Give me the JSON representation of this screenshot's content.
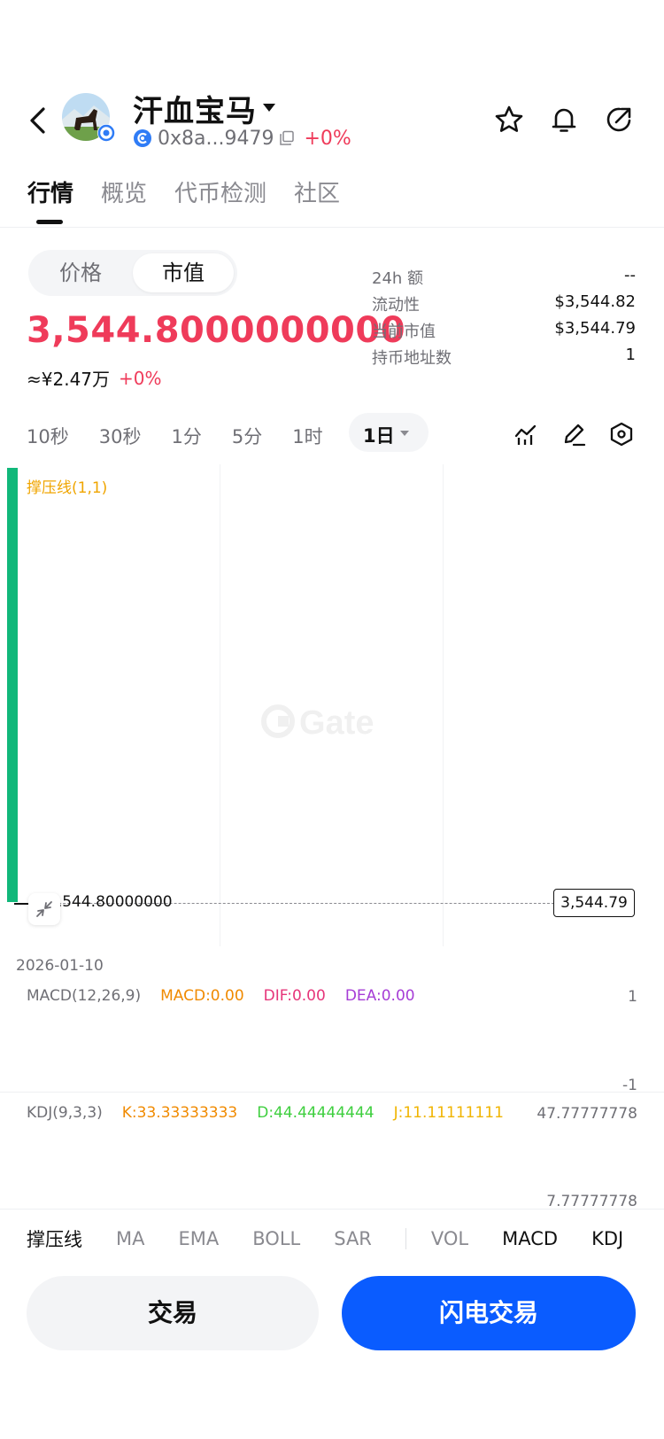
{
  "header": {
    "token_name": "汗血宝马",
    "address": "0x8a...9479",
    "change": "+0%"
  },
  "tabs": [
    {
      "label": "行情",
      "active": true
    },
    {
      "label": "概览",
      "active": false
    },
    {
      "label": "代币检测",
      "active": false
    },
    {
      "label": "社区",
      "active": false
    }
  ],
  "toggle": {
    "price": "价格",
    "market_cap": "市值",
    "selected": "市值"
  },
  "summary": {
    "value": "3,544.8000000000",
    "cny": "≈¥2.47万",
    "change": "+0%"
  },
  "stats": [
    {
      "label": "24h  额",
      "value": "--"
    },
    {
      "label": "流动性",
      "value": "$3,544.82"
    },
    {
      "label": "当前市值",
      "value": "$3,544.79"
    },
    {
      "label": "持币地址数",
      "value": "1"
    }
  ],
  "intervals": [
    "10秒",
    "30秒",
    "1分",
    "5分",
    "1时"
  ],
  "selected_interval": "1日",
  "chart": {
    "sr_label": "撑压线(1,1)",
    "line_price": "3,544.80000000",
    "last_price": "3,544.79",
    "date": "2026-01-10",
    "watermark": "Gate"
  },
  "macd": {
    "name": "MACD(12,26,9)",
    "macd": "MACD:0.00",
    "dif": "DIF:0.00",
    "dea": "DEA:0.00",
    "top": "1",
    "bottom": "-1",
    "colors": {
      "macd": "#f08a00",
      "dif": "#e6357a",
      "dea": "#a63dd6"
    }
  },
  "kdj": {
    "name": "KDJ(9,3,3)",
    "k": "K:33.33333333",
    "d": "D:44.44444444",
    "j": "J:11.11111111",
    "top": "47.77777778",
    "bottom": "7.77777778",
    "colors": {
      "k": "#f08a00",
      "d": "#3fcf3f",
      "j": "#f0b400"
    }
  },
  "indicator_tabs": [
    {
      "label": "撑压线",
      "on": true
    },
    {
      "label": "MA",
      "on": false
    },
    {
      "label": "EMA",
      "on": false
    },
    {
      "label": "BOLL",
      "on": false
    },
    {
      "label": "SAR",
      "on": false
    },
    {
      "label": "VOL",
      "on": false
    },
    {
      "label": "MACD",
      "on": true
    },
    {
      "label": "KDJ",
      "on": true
    }
  ],
  "buttons": {
    "trade": "交易",
    "flash_trade": "闪电交易"
  },
  "colors": {
    "up": "#ef3b5a",
    "primary": "#0a5cff",
    "candle": "#11b87a",
    "sr_line": "#f0a500"
  }
}
